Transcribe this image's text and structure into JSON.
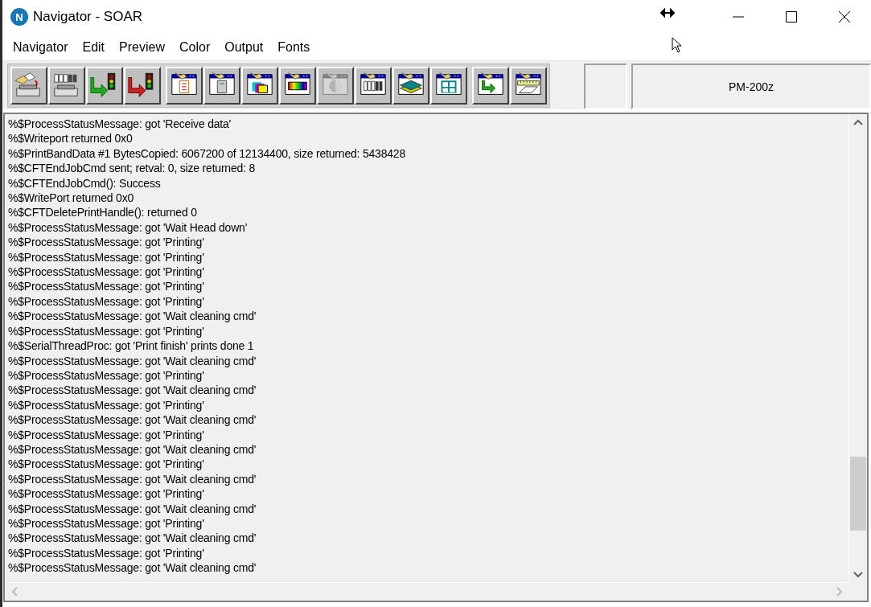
{
  "window": {
    "title": "Navigator - SOAR",
    "logo_letter": "N"
  },
  "menu": [
    "Navigator",
    "Edit",
    "Preview",
    "Color",
    "Output",
    "Fonts"
  ],
  "toolbar": {
    "groups": [
      [
        {
          "kind": "load-printer",
          "disabled": false
        },
        {
          "kind": "band-printer",
          "disabled": false
        },
        {
          "kind": "go-signal",
          "disabled": false
        },
        {
          "kind": "stop-signal",
          "disabled": false
        }
      ],
      [
        {
          "kind": "page",
          "disabled": false
        },
        {
          "kind": "file",
          "disabled": false
        },
        {
          "kind": "layers",
          "disabled": false
        },
        {
          "kind": "spectrum",
          "disabled": false
        },
        {
          "kind": "half-circle",
          "disabled": true
        },
        {
          "kind": "band",
          "disabled": false
        },
        {
          "kind": "stack",
          "disabled": false
        },
        {
          "kind": "grid",
          "disabled": false
        }
      ],
      [
        {
          "kind": "arrow",
          "disabled": false
        },
        {
          "kind": "ruler",
          "disabled": false
        }
      ]
    ],
    "status_panel": "PM-200z"
  },
  "log": [
    "%$ProcessStatusMessage: got 'Receive data'",
    "%$Writeport returned 0x0",
    "%$PrintBandData #1 BytesCopied: 6067200 of 12134400, size returned: 5438428",
    "%$CFTEndJobCmd sent; retval: 0, size returned: 8",
    "%$CFTEndJobCmd(): Success",
    "%$WritePort returned 0x0",
    "%$CFTDeletePrintHandle(): returned 0",
    "%$ProcessStatusMessage: got 'Wait Head down'",
    "%$ProcessStatusMessage: got 'Printing'",
    "%$ProcessStatusMessage: got 'Printing'",
    "%$ProcessStatusMessage: got 'Printing'",
    "%$ProcessStatusMessage: got 'Printing'",
    "%$ProcessStatusMessage: got 'Printing'",
    "%$ProcessStatusMessage: got 'Wait cleaning cmd'",
    "%$ProcessStatusMessage: got 'Printing'",
    "%$SerialThreadProc: got 'Print finish' prints done 1",
    "%$ProcessStatusMessage: got 'Wait cleaning cmd'",
    "%$ProcessStatusMessage: got 'Printing'",
    "%$ProcessStatusMessage: got 'Wait cleaning cmd'",
    "%$ProcessStatusMessage: got 'Printing'",
    "%$ProcessStatusMessage: got 'Wait cleaning cmd'",
    "%$ProcessStatusMessage: got 'Printing'",
    "%$ProcessStatusMessage: got 'Wait cleaning cmd'",
    "%$ProcessStatusMessage: got 'Printing'",
    "%$ProcessStatusMessage: got 'Wait cleaning cmd'",
    "%$ProcessStatusMessage: got 'Printing'",
    "%$ProcessStatusMessage: got 'Wait cleaning cmd'",
    "%$ProcessStatusMessage: got 'Printing'",
    "%$ProcessStatusMessage: got 'Wait cleaning cmd'",
    "%$ProcessStatusMessage: got 'Printing'",
    "%$ProcessStatusMessage: got 'Wait cleaning cmd'"
  ]
}
